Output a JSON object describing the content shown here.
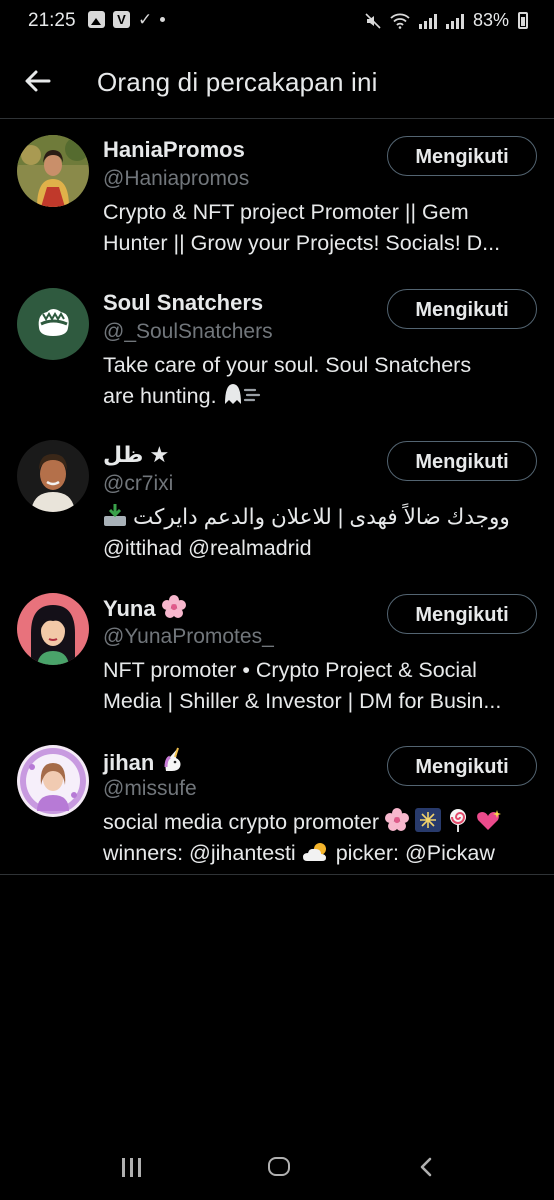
{
  "status_bar": {
    "time": "21:25",
    "battery": "83%"
  },
  "header": {
    "title": "Orang di percakapan ini"
  },
  "users": [
    {
      "name": "HaniaPromos",
      "handle": "@Haniapromos",
      "bio_line1": "Crypto & NFT project Promoter || Gem",
      "bio_line2": "Hunter || Grow your Projects! Socials! D...",
      "follow_label": "Mengikuti",
      "avatar": "photo-woman-yellow"
    },
    {
      "name": "Soul Snatchers",
      "handle": "@_SoulSnatchers",
      "bio_line1": "Take care of your soul. Soul Snatchers",
      "bio_line2": "are hunting.",
      "follow_label": "Mengikuti",
      "avatar": "green-logo"
    },
    {
      "name": "ظل ★",
      "handle": "@cr7ixi",
      "bio_line1": "ووجدك ضالاً فهدى | للاعلان والدعم دايركت",
      "bio_line2": "@ittihad @realmadrid",
      "follow_label": "Mengikuti",
      "avatar": "photo-man"
    },
    {
      "name": "Yuna",
      "handle": "@YunaPromotes_",
      "bio_line1": "NFT promoter • Crypto Project & Social",
      "bio_line2": "Media | Shiller & Investor | DM for Busin...",
      "follow_label": "Mengikuti",
      "avatar": "illustration-mulan"
    },
    {
      "name": "jihan",
      "handle": "@missufe",
      "bio_line1": "social media crypto promoter",
      "bio_line2": "winners: @jihantesti",
      "bio_line2b": "picker: @Pickaw",
      "follow_label": "Mengikuti",
      "avatar": "illustration-girl-purple"
    }
  ],
  "colors": {
    "background": "#000000",
    "text": "#e7e9ea",
    "secondary": "#71767b",
    "divider": "#2f3336"
  }
}
